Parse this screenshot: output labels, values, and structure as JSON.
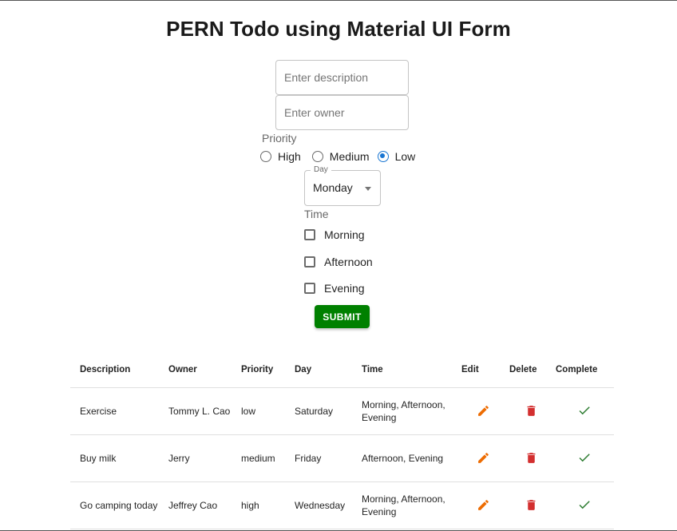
{
  "title": "PERN Todo using Material UI Form",
  "form": {
    "description_placeholder": "Enter description",
    "owner_placeholder": "Enter owner",
    "priority_label": "Priority",
    "priority_options": [
      "High",
      "Medium",
      "Low"
    ],
    "priority_selected": "Low",
    "day_label": "Day",
    "day_value": "Monday",
    "time_label": "Time",
    "time_options": [
      "Morning",
      "Afternoon",
      "Evening"
    ],
    "submit_label": "Submit"
  },
  "table": {
    "headers": [
      "Description",
      "Owner",
      "Priority",
      "Day",
      "Time",
      "Edit",
      "Delete",
      "Complete"
    ],
    "rows": [
      {
        "description": "Exercise",
        "owner": "Tommy L. Cao",
        "priority": "low",
        "day": "Saturday",
        "time": "Morning, Afternoon, Evening"
      },
      {
        "description": "Buy milk",
        "owner": "Jerry",
        "priority": "medium",
        "day": "Friday",
        "time": "Afternoon, Evening"
      },
      {
        "description": "Go camping today",
        "owner": "Jeffrey Cao",
        "priority": "high",
        "day": "Wednesday",
        "time": "Morning, Afternoon, Evening"
      }
    ]
  },
  "icons": {
    "edit": "pencil-icon",
    "delete": "trash-icon",
    "complete": "check-icon"
  },
  "colors": {
    "submit_bg": "#008000",
    "radio_accent": "#1976d2",
    "edit_icon": "#ed6c02",
    "delete_icon": "#d32f2f",
    "complete_icon": "#2e7d32"
  }
}
